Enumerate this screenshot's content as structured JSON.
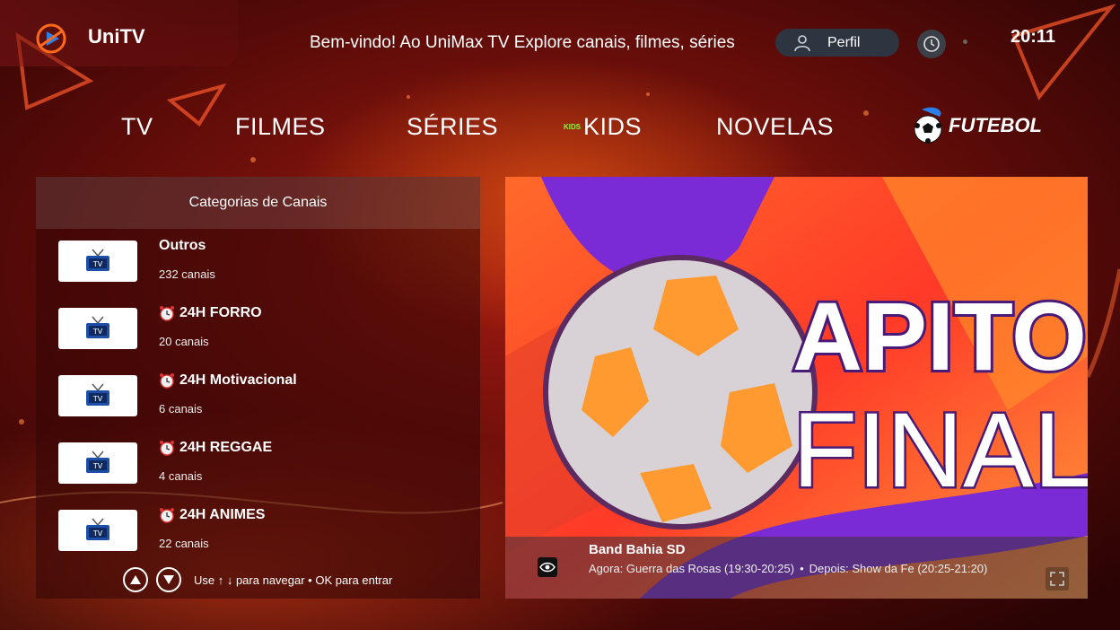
{
  "header": {
    "app_title": "UniTV",
    "welcome_text": "Bem-vindo! Ao UniMax TV  Explore canais, filmes, séries",
    "profile_label": "Perfil",
    "time": "20:11"
  },
  "nav": {
    "items": [
      {
        "label": "TV"
      },
      {
        "label": "FILMES"
      },
      {
        "label": "SÉRIES"
      },
      {
        "label": "KIDS"
      },
      {
        "label": "NOVELAS"
      },
      {
        "label": "FUTEBOL"
      }
    ],
    "kids_tag": "KIDS"
  },
  "panel": {
    "title": "Categorias de Canais",
    "thumb_label": "TV",
    "categories": [
      {
        "name": "Outros",
        "count": "232 canais",
        "icon": "none"
      },
      {
        "name": "24H  FORRO",
        "count": "20 canais",
        "icon": "alarm-clock-icon"
      },
      {
        "name": "24H  Motivacional",
        "count": "6 canais",
        "icon": "alarm-clock-icon"
      },
      {
        "name": "24H  REGGAE",
        "count": "4 canais",
        "icon": "alarm-clock-icon"
      },
      {
        "name": "24H ANIMES",
        "count": "22 canais",
        "icon": "alarm-clock-icon"
      }
    ],
    "footer_hint": "Use ↑ ↓ para navegar • OK para entrar"
  },
  "player": {
    "artwork_text_1": "APITO",
    "artwork_text_2": "FINAL",
    "channel_name": "Band Bahia SD",
    "now": "Agora: Guerra das Rosas (19:30-20:25)",
    "separator": "•",
    "next": "Depois: Show da Fe (20:25-21:20)"
  },
  "colors": {
    "accent_orange": "#ff6a1a",
    "background_red": "#8a140e",
    "pill_bg": "#2e3440",
    "kids_green": "#7cff3a",
    "art_purple": "#7a2bd6"
  }
}
